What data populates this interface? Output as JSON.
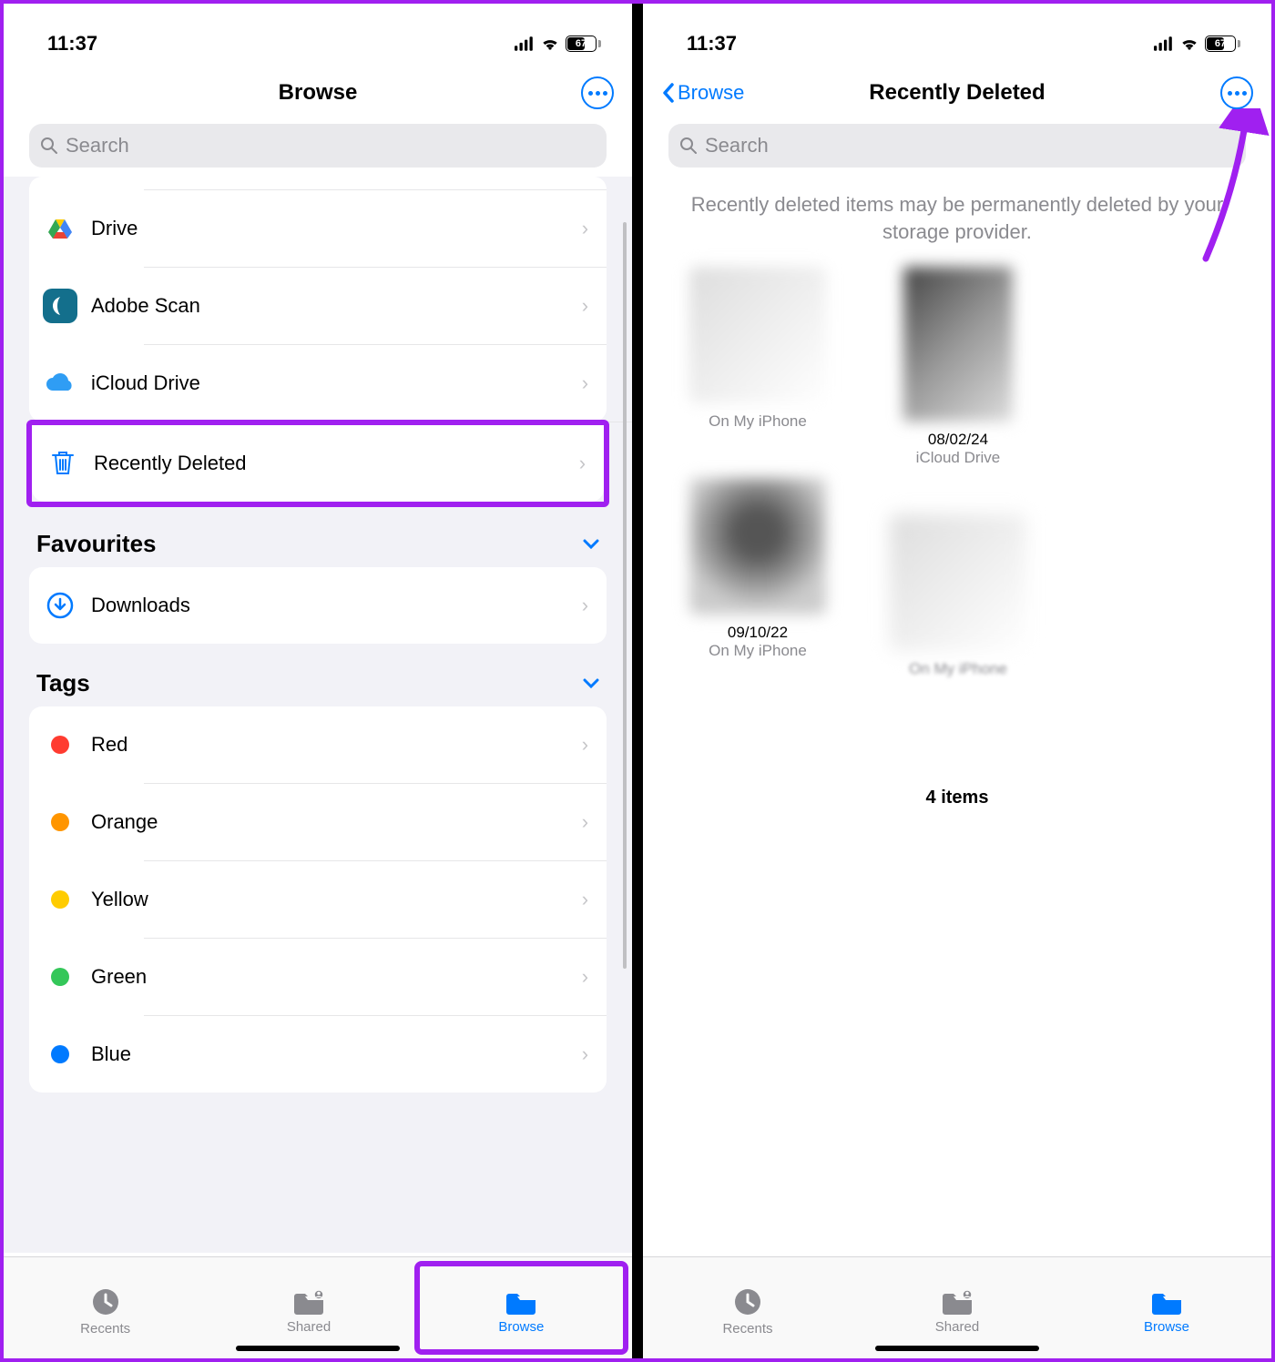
{
  "left": {
    "status_time": "11:37",
    "battery": "67",
    "title": "Browse",
    "search_placeholder": "Search",
    "locations": [
      {
        "label": "Drive",
        "icon": "drive"
      },
      {
        "label": "Adobe Scan",
        "icon": "adobe"
      },
      {
        "label": "iCloud Drive",
        "icon": "icloud"
      },
      {
        "label": "Recently Deleted",
        "icon": "trash",
        "highlighted": true
      }
    ],
    "favourites_title": "Favourites",
    "favourites": [
      {
        "label": "Downloads",
        "icon": "download"
      }
    ],
    "tags_title": "Tags",
    "tags": [
      {
        "label": "Red",
        "color": "#ff3b30"
      },
      {
        "label": "Orange",
        "color": "#ff9500"
      },
      {
        "label": "Yellow",
        "color": "#ffcc00"
      },
      {
        "label": "Green",
        "color": "#34c759"
      },
      {
        "label": "Blue",
        "color": "#007aff"
      }
    ],
    "tabs": {
      "recents": "Recents",
      "shared": "Shared",
      "browse": "Browse"
    }
  },
  "right": {
    "status_time": "11:37",
    "battery": "67",
    "back_label": "Browse",
    "title": "Recently Deleted",
    "search_placeholder": "Search",
    "notice": "Recently deleted items may be permanently deleted by your storage provider.",
    "items": [
      {
        "date": "",
        "loc": "On My iPhone"
      },
      {
        "date": "08/02/24",
        "loc": "iCloud Drive"
      },
      {
        "date": "09/10/22",
        "loc": "On My iPhone"
      },
      {
        "date": "",
        "loc": "On My iPhone"
      }
    ],
    "count": "4 items",
    "tabs": {
      "recents": "Recents",
      "shared": "Shared",
      "browse": "Browse"
    }
  }
}
